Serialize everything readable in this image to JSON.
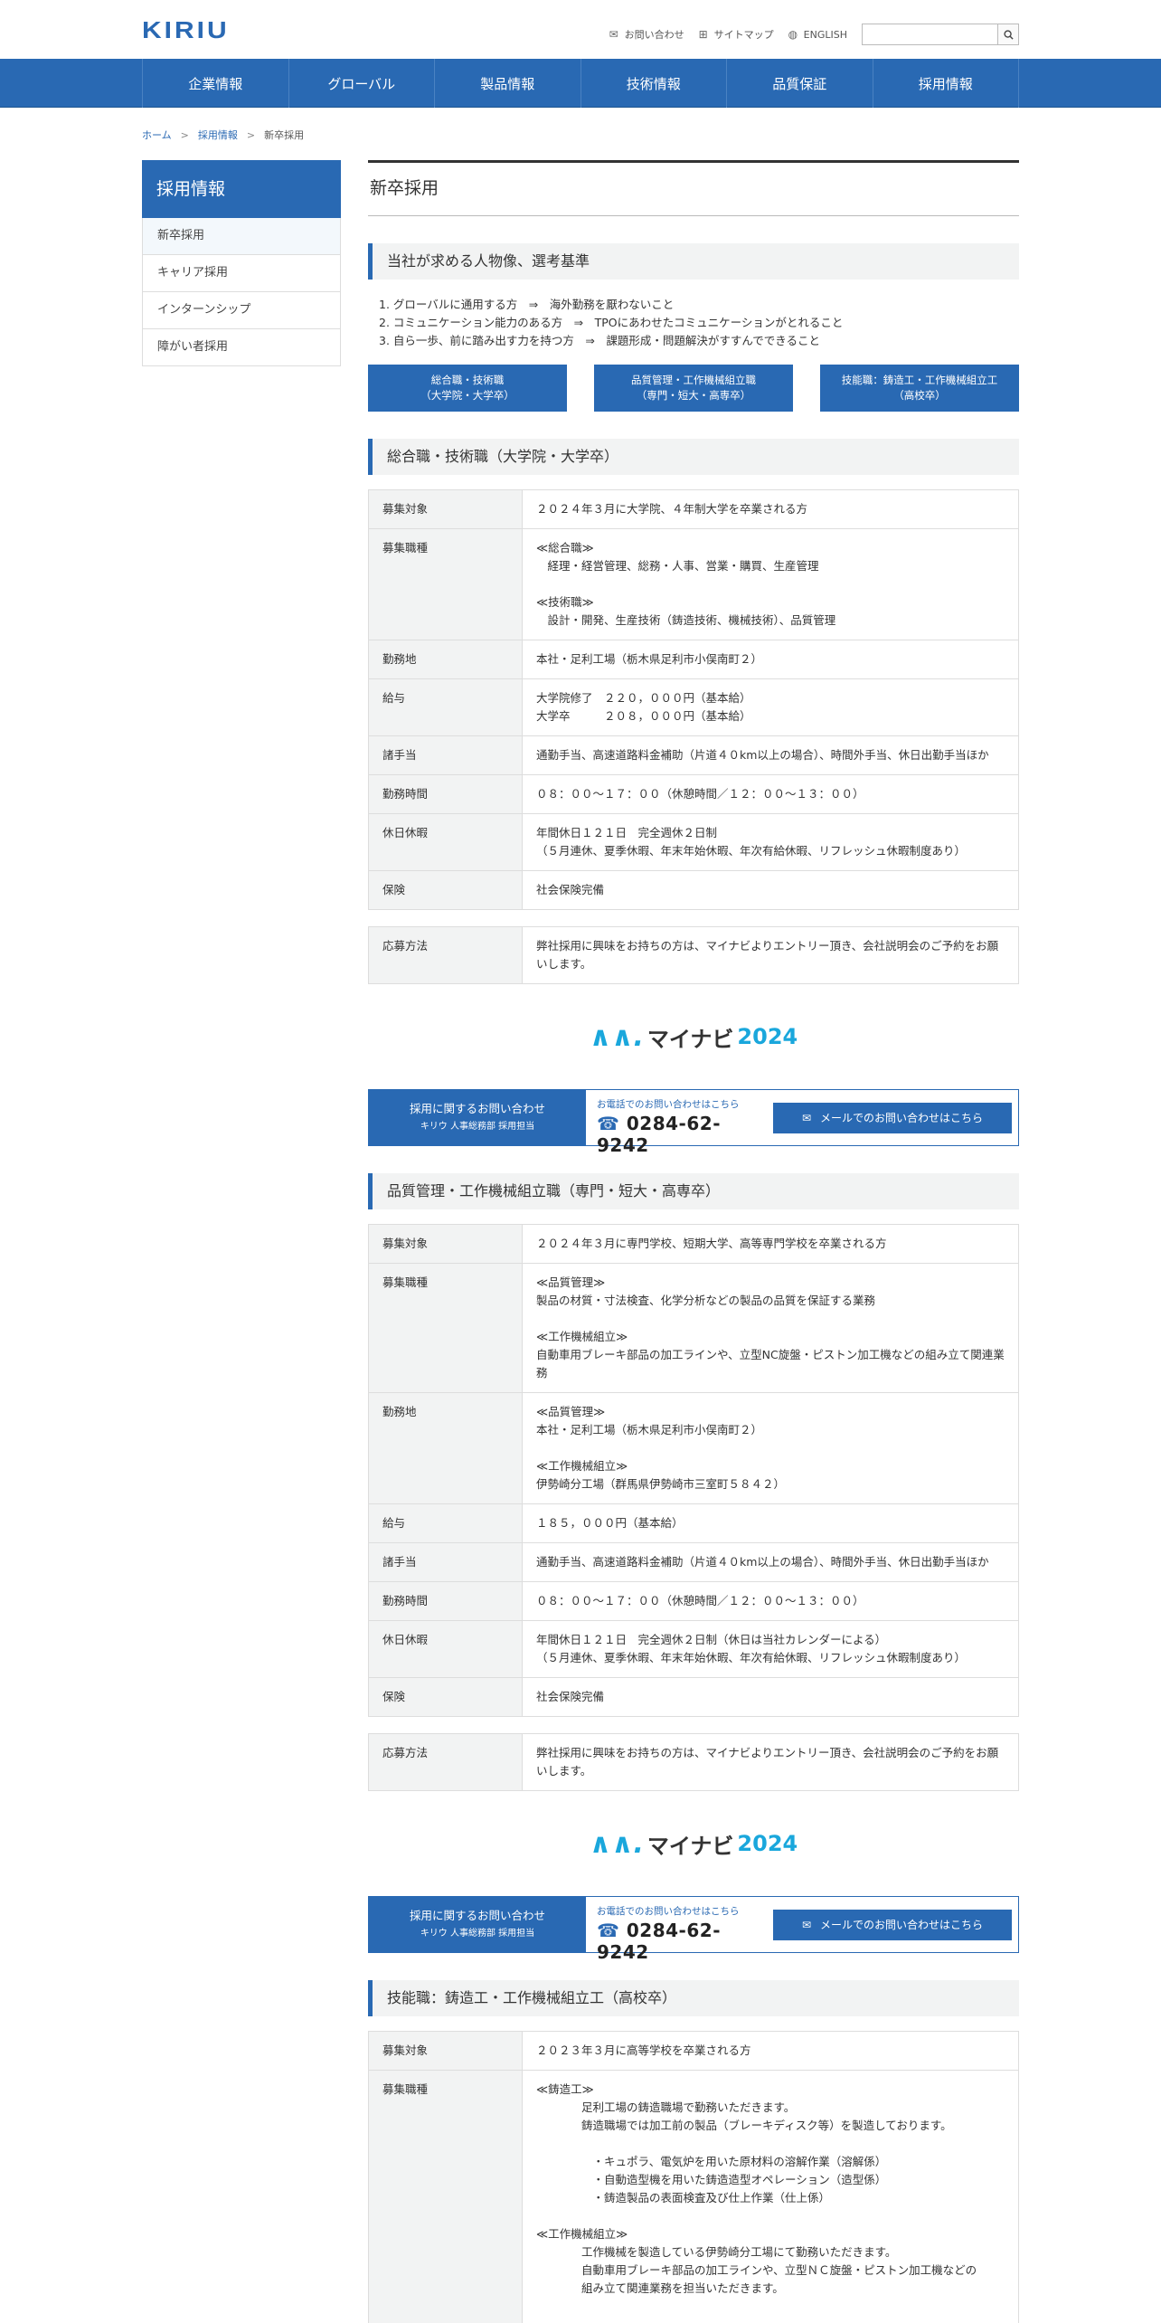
{
  "header": {
    "logo": "KIRIU",
    "util": {
      "contact": "お問い合わせ",
      "sitemap": "サイトマップ",
      "english": "ENGLISH"
    },
    "search_placeholder": ""
  },
  "nav": [
    "企業情報",
    "グローバル",
    "製品情報",
    "技術情報",
    "品質保証",
    "採用情報"
  ],
  "breadcrumb": {
    "home": "ホーム",
    "recruit": "採用情報",
    "current": "新卒採用",
    "sep": ">"
  },
  "sidebar": {
    "title": "採用情報",
    "items": [
      "新卒採用",
      "キャリア採用",
      "インターンシップ",
      "障がい者採用"
    ]
  },
  "main": {
    "title": "新卒採用",
    "criteria_heading": "当社が求める人物像、選考基準",
    "criteria": [
      "1. グローバルに通用する方　⇒　海外勤務を厭わないこと",
      "2. コミュニケーション能力のある方　⇒　TPOにあわせたコミュニケーションがとれること",
      "3. 自ら一歩、前に踏み出す力を持つ方　⇒　課題形成・問題解決がすすんでできること"
    ],
    "job_buttons": [
      {
        "l1": "総合職・技術職",
        "l2": "（大学院・大学卒）"
      },
      {
        "l1": "品質管理・工作機械組立職",
        "l2": "（専門・短大・高専卒）"
      },
      {
        "l1": "技能職：鋳造工・工作機械組立工",
        "l2": "（高校卒）"
      }
    ],
    "sections": [
      {
        "heading": "総合職・技術職（大学院・大学卒）",
        "rows": [
          {
            "k": "募集対象",
            "v": "２０２４年３月に大学院、４年制大学を卒業される方"
          },
          {
            "k": "募集職種",
            "v": "≪総合職≫\n　経理・経営管理、総務・人事、営業・購買、生産管理\n\n≪技術職≫\n　設計・開発、生産技術（鋳造技術、機械技術）、品質管理"
          },
          {
            "k": "勤務地",
            "v": "本社・足利工場（栃木県足利市小俣南町２）"
          },
          {
            "k": "給与",
            "v": "大学院修了　２２０，０００円（基本給）\n大学卒　　　２０８，０００円（基本給）"
          },
          {
            "k": "諸手当",
            "v": "通勤手当、高速道路料金補助（片道４０km以上の場合）、時間外手当、休日出勤手当ほか"
          },
          {
            "k": "勤務時間",
            "v": "０８：００～１７：００（休憩時間／１２：００～１３：００）"
          },
          {
            "k": "休日休暇",
            "v": "年間休日１２１日　完全週休２日制\n（５月連休、夏季休暇、年末年始休暇、年次有給休暇、リフレッシュ休暇制度あり）"
          },
          {
            "k": "保険",
            "v": "社会保険完備"
          }
        ],
        "apply": {
          "k": "応募方法",
          "v": "弊社採用に興味をお持ちの方は、マイナビよりエントリー頂き、会社説明会のご予約をお願いします。"
        }
      },
      {
        "heading": "品質管理・工作機械組立職（専門・短大・高専卒）",
        "rows": [
          {
            "k": "募集対象",
            "v": "２０２４年３月に専門学校、短期大学、高等専門学校を卒業される方"
          },
          {
            "k": "募集職種",
            "v": "≪品質管理≫\n製品の材質・寸法検査、化学分析などの製品の品質を保証する業務\n\n≪工作機械組立≫\n自動車用ブレーキ部品の加工ラインや、立型NC旋盤・ピストン加工機などの組み立て関連業務"
          },
          {
            "k": "勤務地",
            "v": "≪品質管理≫\n本社・足利工場（栃木県足利市小俣南町２）\n\n≪工作機械組立≫\n伊勢崎分工場（群馬県伊勢崎市三室町５８４２）"
          },
          {
            "k": "給与",
            "v": "１８５，０００円（基本給）"
          },
          {
            "k": "諸手当",
            "v": "通勤手当、高速道路料金補助（片道４０km以上の場合）、時間外手当、休日出勤手当ほか"
          },
          {
            "k": "勤務時間",
            "v": "０８：００～１７：００（休憩時間／１２：００～１３：００）"
          },
          {
            "k": "休日休暇",
            "v": "年間休日１２１日　完全週休２日制（休日は当社カレンダーによる）\n（５月連休、夏季休暇、年末年始休暇、年次有給休暇、リフレッシュ休暇制度あり）"
          },
          {
            "k": "保険",
            "v": "社会保険完備"
          }
        ],
        "apply": {
          "k": "応募方法",
          "v": "弊社採用に興味をお持ちの方は、マイナビよりエントリー頂き、会社説明会のご予約をお願いします。"
        }
      },
      {
        "heading": "技能職：鋳造工・工作機械組立工（高校卒）",
        "rows": [
          {
            "k": "募集対象",
            "v": "２０２３年３月に高等学校を卒業される方"
          },
          {
            "k": "募集職種",
            "v": "≪鋳造工≫\n　　　　足利工場の鋳造職場で勤務いただきます。\n　　　　鋳造職場では加工前の製品（ブレーキディスク等）を製造しております。\n\n　　　　　・キュポラ、電気炉を用いた原材料の溶解作業（溶解係）\n　　　　　・自動造型機を用いた鋳造造型オペレーション（造型係）\n　　　　　・鋳造製品の表面検査及び仕上作業（仕上係）\n\n≪工作機械組立≫\n　　　　工作機械を製造している伊勢崎分工場にて勤務いただきます。\n　　　　自動車用ブレーキ部品の加工ラインや、立型ＮＣ旋盤・ピストン加工機などの\n　　　　組み立て関連業務を担当いただきます。"
          }
        ]
      }
    ],
    "mynavi": {
      "mark": "∧∧.",
      "text": "マイナビ",
      "year": "2024"
    },
    "contact": {
      "title": "採用に関するお問い合わせ",
      "sub": "キリウ 人事総務部 採用担当",
      "tel_label": "お電話でのお問い合わせはこちら",
      "tel": "0284-62-9242",
      "mail": "メールでのお問い合わせはこちら"
    }
  }
}
